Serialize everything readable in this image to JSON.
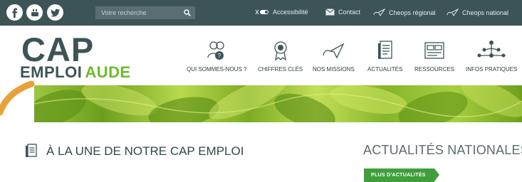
{
  "topbar": {
    "social_icons": [
      "facebook-icon",
      "youtube-icon",
      "twitter-icon"
    ],
    "search": {
      "placeholder": "Votre recherche"
    },
    "links": {
      "accessibility": "Accessibilité",
      "contact": "Contact",
      "cheops_regional": "Cheops régional",
      "cheops_national": "Cheops national"
    }
  },
  "logo": {
    "line1": "CAP",
    "line2a": "EMPLOI",
    "line2b": "AUDE"
  },
  "nav": {
    "items": [
      {
        "label": "QUI SOMMES-NOUS ?",
        "icon": "people-icon"
      },
      {
        "label": "CHIFFRES CLÉS",
        "icon": "award-icon"
      },
      {
        "label": "NOS MISSIONS",
        "icon": "paper-plane-icon"
      },
      {
        "label": "ACTUALITÉS",
        "icon": "document-icon"
      },
      {
        "label": "RESSOURCES",
        "icon": "folder-icon"
      },
      {
        "label": "INFOS PRATIQUES",
        "icon": "network-icon"
      }
    ]
  },
  "content": {
    "section_title": "À LA UNE DE NOTRE CAP EMPLOI",
    "national_title": "ACTUALITÉS NATIONALES",
    "more_button": "PLUS D'ACTUALITÉS"
  },
  "colors": {
    "topbar": "#3d5457",
    "logo_dark": "#3d5457",
    "logo_green": "#6dbb2a",
    "button_green": "#3e9f3c",
    "swoosh_orange": "#e8a23a"
  }
}
